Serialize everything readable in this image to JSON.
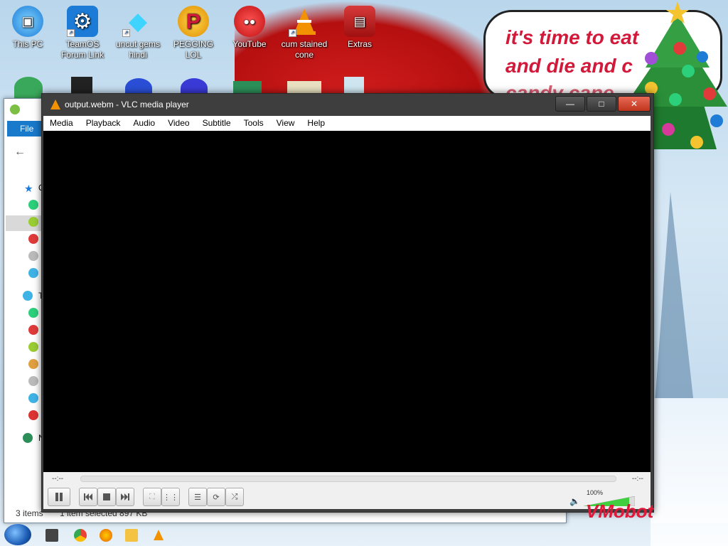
{
  "desktop_icons": [
    {
      "label": "This PC",
      "icon": "computer-icon"
    },
    {
      "label": "TeamOS Forum Link",
      "icon": "gear-icon"
    },
    {
      "label": "uncut gems hindi",
      "icon": "diamond-icon"
    },
    {
      "label": "PEGGING LOL",
      "icon": "p-logo-icon"
    },
    {
      "label": "YouTube",
      "icon": "angry-bird-icon"
    },
    {
      "label": "cum stained cone",
      "icon": "vlc-cone-icon"
    },
    {
      "label": "Extras",
      "icon": "folder-icon"
    }
  ],
  "wallpaper": {
    "speech_lines": [
      "it's time to eat",
      "and die and c",
      "candy cane"
    ],
    "signature": "VMobot"
  },
  "explorer": {
    "ribbon_file": "File",
    "nav_letters": [
      "Q",
      "T",
      "N"
    ],
    "status_items": "3 items",
    "status_selected": "1 item selected  897 KB"
  },
  "vlc": {
    "title": "output.webm - VLC media player",
    "menu": [
      "Media",
      "Playback",
      "Audio",
      "Video",
      "Subtitle",
      "Tools",
      "View",
      "Help"
    ],
    "time_elapsed": "--:--",
    "time_total": "--:--",
    "volume": "100%",
    "volume_level": 1.0
  },
  "colors": {
    "vlc_orange": "#f39200",
    "speech_red": "#d2193a"
  }
}
